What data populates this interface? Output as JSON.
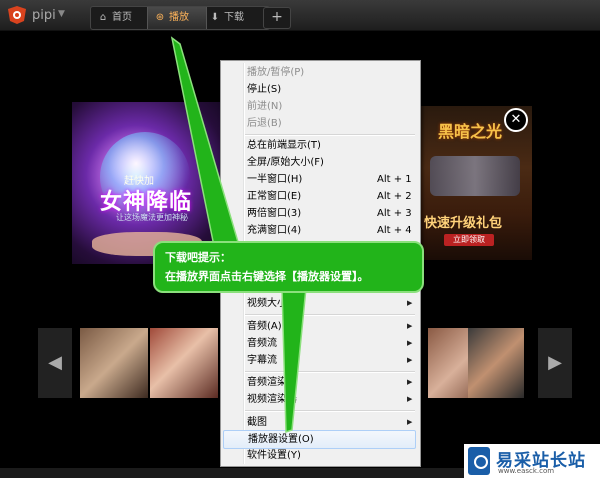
{
  "app": {
    "name": "pipi"
  },
  "tabs": [
    {
      "label": "首页",
      "icon": "home-icon"
    },
    {
      "label": "播放",
      "icon": "play-icon",
      "active": true
    },
    {
      "label": "下载",
      "icon": "download-icon"
    }
  ],
  "add_tab_label": "+",
  "ads": {
    "left": {
      "line1": "赶快加",
      "line2": "女神降临",
      "line3": "让这场魔法更加神秘"
    },
    "right": {
      "title": "黑暗之光",
      "subtitle": "快速升级礼包",
      "button": "立即领取"
    },
    "close_label": "✕"
  },
  "nav": {
    "prev": "◀",
    "next": "▶"
  },
  "context_menu": {
    "items": [
      {
        "label": "播放/暂停(P)",
        "disabled": true
      },
      {
        "label": "停止(S)"
      },
      {
        "label": "前进(N)",
        "disabled": true
      },
      {
        "label": "后退(B)",
        "disabled": true
      },
      {
        "separator": true
      },
      {
        "label": "总在前端显示(T)"
      },
      {
        "label": "全屏/原始大小(F)"
      },
      {
        "label": "一半窗口(H)",
        "shortcut": "Alt + 1"
      },
      {
        "label": "正常窗口(E)",
        "shortcut": "Alt + 2"
      },
      {
        "label": "两倍窗口(3)",
        "shortcut": "Alt + 3"
      },
      {
        "label": "充满窗口(4)",
        "shortcut": "Alt + 4"
      },
      {
        "label": "视频大小(C)",
        "submenu": true
      },
      {
        "separator": true
      },
      {
        "label": "音频(A)",
        "submenu": true
      },
      {
        "label": "音频流",
        "submenu": true
      },
      {
        "label": "字幕流",
        "submenu": true
      },
      {
        "separator": true
      },
      {
        "label": "音频渲染器",
        "submenu": true
      },
      {
        "label": "视频渲染器",
        "submenu": true
      },
      {
        "separator": true
      },
      {
        "label": "截图",
        "submenu": true
      },
      {
        "label": "播放器设置(O)",
        "highlighted": true
      },
      {
        "label": "软件设置(Y)"
      }
    ]
  },
  "callout": {
    "line1": "下载吧提示：",
    "line2": "在播放界面点击右键选择【播放器设置】。"
  },
  "watermark": {
    "name": "易采站长站",
    "url": "www.easck.com"
  },
  "colors": {
    "callout_green": "#22b41a",
    "active_tab_text": "#ffb45a",
    "brand_blue": "#1a5ea8"
  }
}
